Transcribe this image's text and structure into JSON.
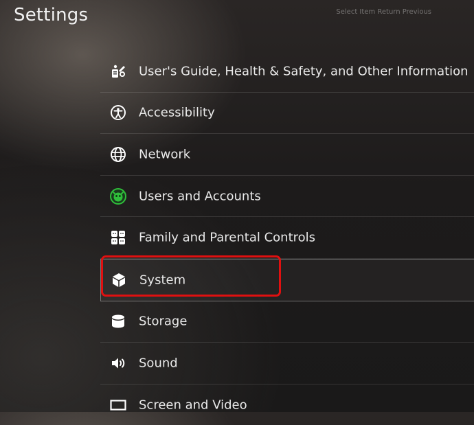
{
  "header": {
    "title": "Settings",
    "top_hint": "Select Item  Return Previous"
  },
  "menu": {
    "items": [
      {
        "label": "User's Guide, Health & Safety, and Other Information",
        "icon": "guide-icon"
      },
      {
        "label": "Accessibility",
        "icon": "accessibility-icon"
      },
      {
        "label": "Network",
        "icon": "globe-icon"
      },
      {
        "label": "Users and Accounts",
        "icon": "user-account-icon"
      },
      {
        "label": "Family and Parental Controls",
        "icon": "family-icon"
      },
      {
        "label": "System",
        "icon": "cube-icon"
      },
      {
        "label": "Storage",
        "icon": "storage-icon"
      },
      {
        "label": "Sound",
        "icon": "speaker-icon"
      },
      {
        "label": "Screen and Video",
        "icon": "screen-icon"
      }
    ],
    "selected_index": 5
  },
  "colors": {
    "highlight": "#e01010",
    "account_icon_accent": "#2fbf3a"
  }
}
